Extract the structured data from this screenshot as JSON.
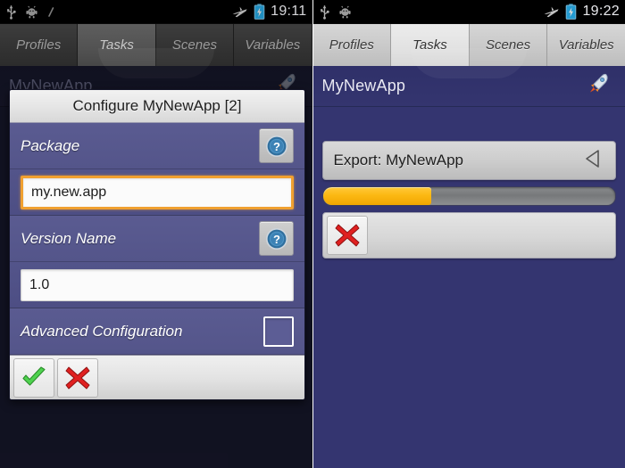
{
  "screens": [
    {
      "id": "left",
      "statusbar": {
        "icons_left": [
          "usb-icon",
          "android-debug-icon",
          "slash-icon"
        ],
        "icons_right": [
          "airplane-mode-icon",
          "battery-charging-icon"
        ],
        "time": "19:11"
      },
      "tabs": [
        {
          "label": "Profiles",
          "active": false
        },
        {
          "label": "Tasks",
          "active": true
        },
        {
          "label": "Scenes",
          "active": false
        },
        {
          "label": "Variables",
          "active": false
        }
      ],
      "app": {
        "title": "MyNewApp",
        "icon": "rocket-icon"
      },
      "dialog": {
        "title": "Configure MyNewApp [2]",
        "rows": [
          {
            "label": "Package",
            "help_icon": "help-question-icon",
            "value": "my.new.app",
            "focused": true
          },
          {
            "label": "Version Name",
            "help_icon": "help-question-icon",
            "value": "1.0",
            "focused": false
          }
        ],
        "advanced": {
          "label": "Advanced Configuration",
          "checked": false
        },
        "buttons": [
          {
            "name": "accept-button",
            "icon": "green-check-icon"
          },
          {
            "name": "cancel-button",
            "icon": "red-cross-icon"
          }
        ]
      }
    },
    {
      "id": "right",
      "statusbar": {
        "icons_left": [
          "usb-icon",
          "android-debug-icon"
        ],
        "icons_right": [
          "airplane-mode-icon",
          "battery-charging-icon"
        ],
        "time": "19:22"
      },
      "tabs": [
        {
          "label": "Profiles",
          "active": false
        },
        {
          "label": "Tasks",
          "active": true
        },
        {
          "label": "Scenes",
          "active": false
        },
        {
          "label": "Variables",
          "active": false
        }
      ],
      "app": {
        "title": "MyNewApp",
        "icon": "rocket-icon"
      },
      "export": {
        "title": "Export: MyNewApp",
        "collapse_icon": "triangle-left-icon",
        "progress_percent": 37,
        "cancel_icon": "red-cross-icon"
      }
    }
  ],
  "colors": {
    "app_background": "#343570",
    "dimmed_background": "#1b1c33",
    "dialog_row": "#5a5b91",
    "focus_orange": "#f0a030",
    "progress_fill": "#fcb813",
    "progress_track": "#7b7d7f"
  }
}
